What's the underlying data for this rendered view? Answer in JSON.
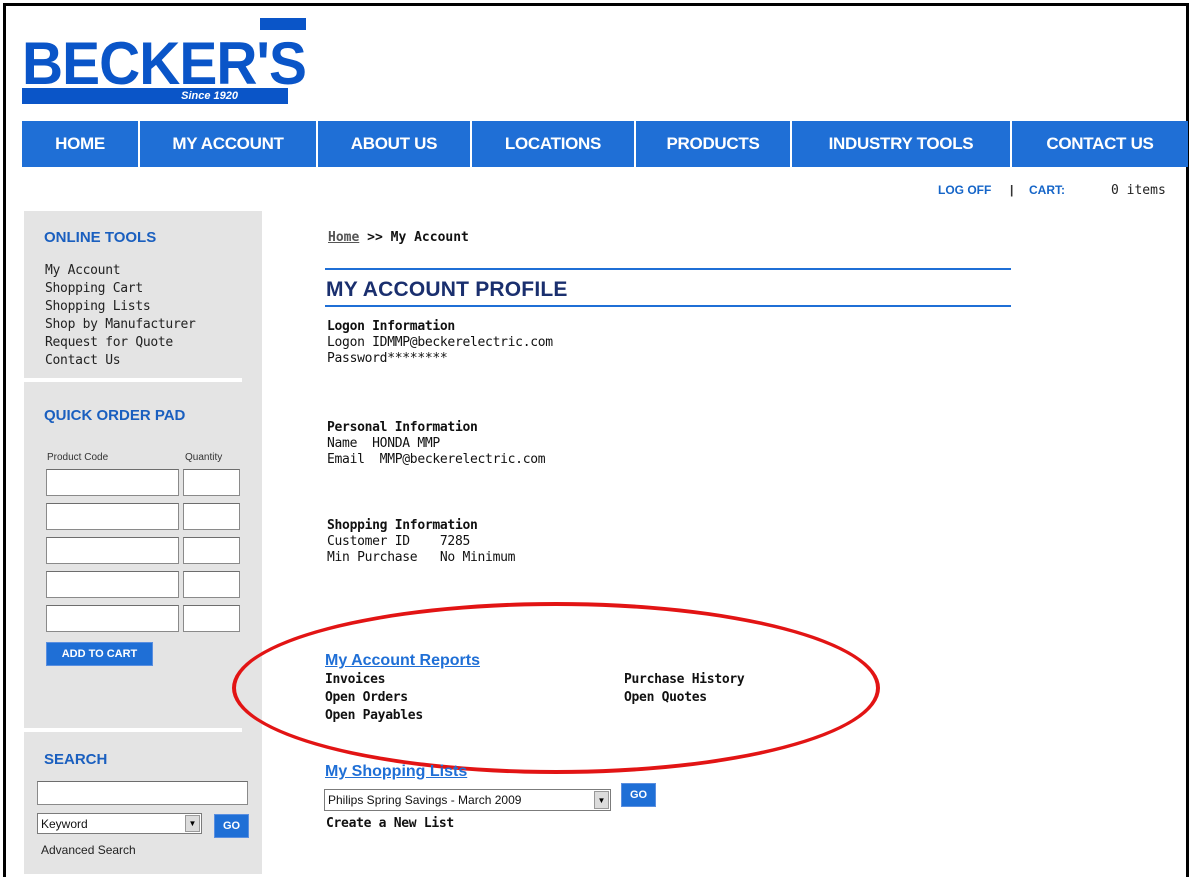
{
  "logo": {
    "text": "BECKER'S",
    "tagline": "Since 1920"
  },
  "nav": [
    {
      "label": "HOME"
    },
    {
      "label": "MY ACCOUNT"
    },
    {
      "label": "ABOUT US"
    },
    {
      "label": "LOCATIONS"
    },
    {
      "label": "PRODUCTS"
    },
    {
      "label": "INDUSTRY TOOLS"
    },
    {
      "label": "CONTACT US"
    }
  ],
  "topbar": {
    "logoff": "LOG OFF",
    "separator": "|",
    "cart_label": "CART:",
    "cart_items": "0 items"
  },
  "sidebar": {
    "online_tools_title": "ONLINE TOOLS",
    "links": [
      "My Account",
      "Shopping Cart",
      "Shopping Lists",
      "Shop by Manufacturer",
      "Request for Quote",
      "Contact Us"
    ],
    "quick_order_title": "QUICK ORDER PAD",
    "product_code_label": "Product Code",
    "quantity_label": "Quantity",
    "add_to_cart": "ADD TO CART",
    "search_title": "SEARCH",
    "search_value": "",
    "search_type": "Keyword",
    "go": "GO",
    "advanced_search": "Advanced Search"
  },
  "breadcrumb": {
    "home": "Home",
    "rest": " >> My Account"
  },
  "main": {
    "title": "MY ACCOUNT PROFILE",
    "logon_heading": "Logon Information",
    "logon_id": "Logon IDMMP@beckerelectric.com",
    "password": "Password********",
    "personal_heading": "Personal Information",
    "name": "Name  HONDA MMP",
    "email": "Email  MMP@beckerelectric.com",
    "shopping_heading": "Shopping Information",
    "customer_id": "Customer ID    7285",
    "min_purchase": "Min Purchase   No Minimum",
    "reports_title": "My Account Reports",
    "reports": {
      "invoices": "Invoices",
      "open_orders": "Open Orders",
      "open_payables": "Open Payables",
      "purchase_history": "Purchase History",
      "open_quotes": "Open Quotes"
    },
    "lists_title": "My Shopping Lists",
    "list_selected": "Philips Spring Savings - March 2009",
    "go": "GO",
    "create_list": "Create a New List"
  },
  "colors": {
    "brand_blue": "#1f6fd6",
    "highlight_red": "#e21414",
    "sidebar_gray": "#e4e4e4"
  }
}
